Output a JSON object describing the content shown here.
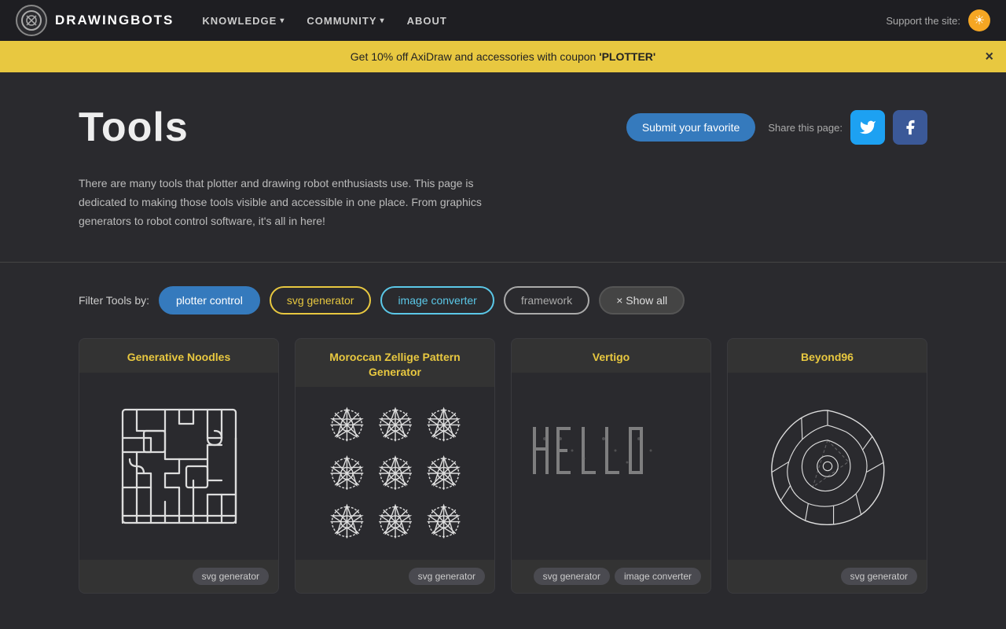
{
  "nav": {
    "logo_symbol": "◎",
    "logo_text": "DRAWINGBOTS",
    "links": [
      {
        "label": "KNOWLEDGE",
        "has_dropdown": true
      },
      {
        "label": "COMMUNITY",
        "has_dropdown": true
      },
      {
        "label": "ABOUT",
        "has_dropdown": false
      }
    ],
    "support_text": "Support the site:",
    "theme_icon": "☀"
  },
  "banner": {
    "text_prefix": "Get 10% off AxiDraw and accessories with coupon ",
    "coupon": "'PLOTTER'",
    "close_label": "×"
  },
  "page": {
    "title": "Tools",
    "submit_label": "Submit your favorite",
    "share_label": "Share this page:",
    "description": "There are many tools that plotter and drawing robot enthusiasts use. This page is dedicated to making those tools visible and accessible in one place. From graphics generators to robot control software, it's all in here!"
  },
  "filters": {
    "label": "Filter Tools by:",
    "buttons": [
      {
        "id": "plotter-control",
        "label": "plotter control",
        "style": "plotter"
      },
      {
        "id": "svg-generator",
        "label": "svg generator",
        "style": "svg"
      },
      {
        "id": "image-converter",
        "label": "image converter",
        "style": "image"
      },
      {
        "id": "framework",
        "label": "framework",
        "style": "framework"
      },
      {
        "id": "show-all",
        "label": "× Show all",
        "style": "showall"
      }
    ]
  },
  "tools": [
    {
      "title": "Generative Noodles",
      "tags": [
        "svg generator"
      ],
      "img_type": "noodles"
    },
    {
      "title": "Moroccan Zellige Pattern Generator",
      "tags": [
        "svg generator"
      ],
      "img_type": "zellige"
    },
    {
      "title": "Vertigo",
      "tags": [
        "svg generator",
        "image converter"
      ],
      "img_type": "vertigo"
    },
    {
      "title": "Beyond96",
      "tags": [
        "svg generator"
      ],
      "img_type": "beyond96"
    }
  ]
}
